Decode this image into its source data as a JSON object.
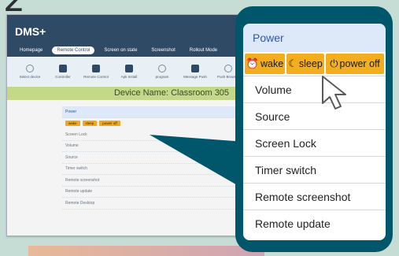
{
  "step": "2",
  "screen": {
    "app_title": "DMS+",
    "tabs": [
      "Homepage",
      "Remote Control",
      "Screen on state",
      "Screenshot",
      "Rollout Mode"
    ],
    "toolbar": [
      "Select device",
      "Controller",
      "Remote Control",
      "Apk Install",
      "program",
      "Message Push",
      "Push Browser"
    ],
    "device_name": "Device Name: Classroom 305",
    "mini_menu": {
      "head": "Power",
      "buttons": [
        "wake",
        "sleep",
        "power off"
      ],
      "items": [
        "Screen Lock",
        "Volume",
        "Source",
        "Timer switch",
        "Remote screenshot",
        "Remote update",
        "Remote Desktop"
      ]
    }
  },
  "callout": {
    "header": "Power",
    "buttons": {
      "wake": "wake",
      "sleep": "sleep",
      "power_off": "power off"
    },
    "items": [
      "Volume",
      "Source",
      "Screen Lock",
      "Timer switch",
      "Remote screenshot",
      "Remote update"
    ]
  },
  "colors": {
    "accent": "#f4ad1c",
    "frame": "#00566b",
    "header_bg": "#dde9f8",
    "header_text": "#2e5aa8"
  }
}
